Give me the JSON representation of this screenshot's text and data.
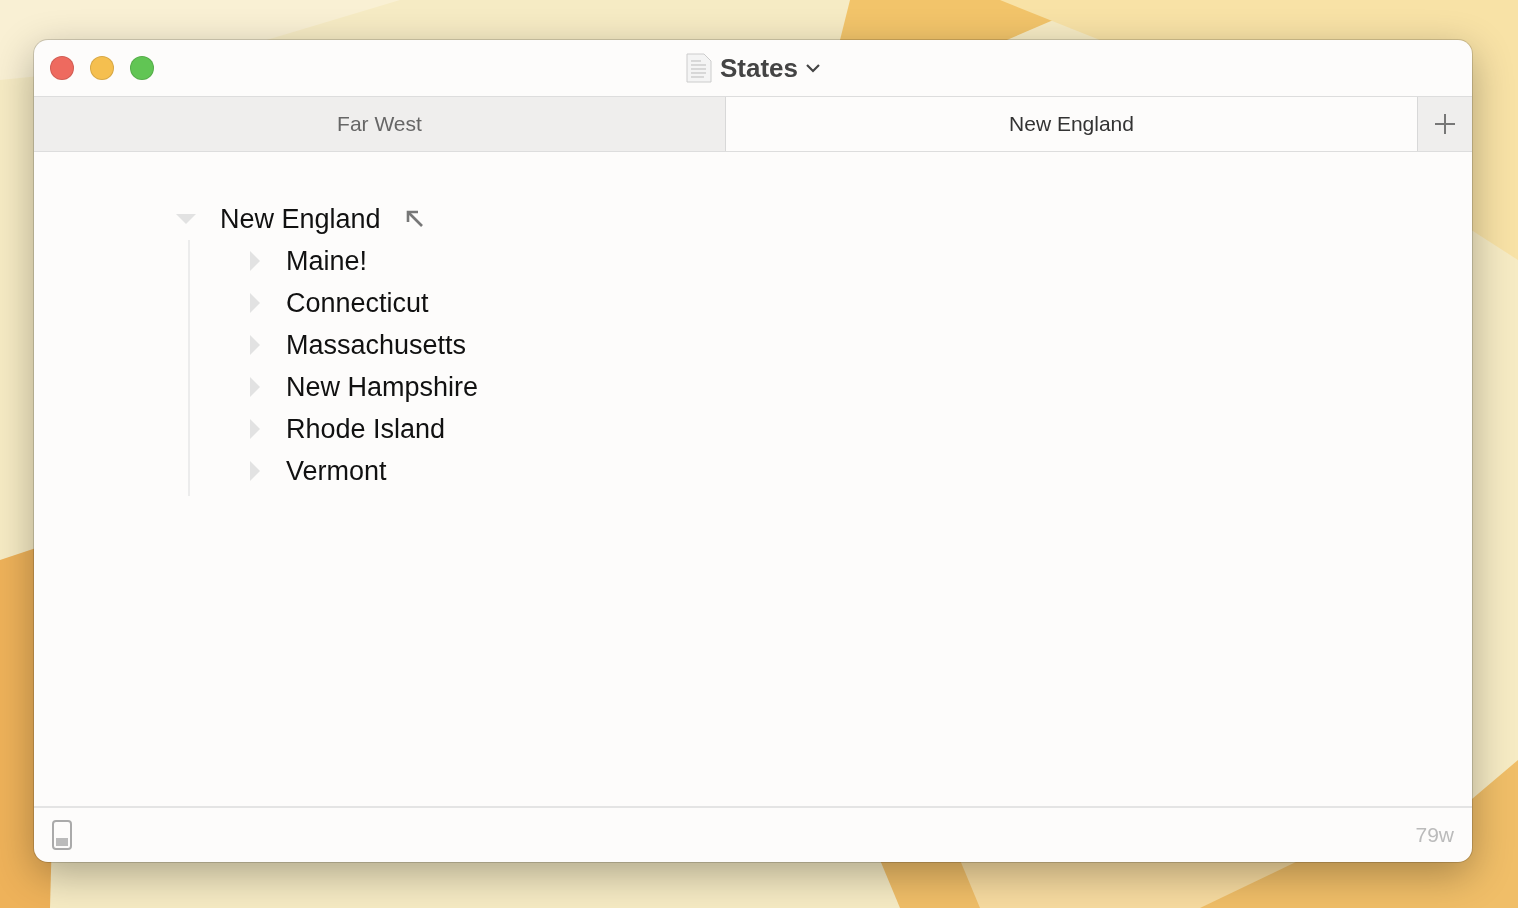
{
  "window": {
    "title": "States"
  },
  "tabs": [
    {
      "label": "Far West",
      "selected": false
    },
    {
      "label": "New England",
      "selected": true
    }
  ],
  "outline": [
    {
      "label": "New England",
      "expanded": true,
      "children": [
        {
          "label": "Maine!",
          "expanded": false
        },
        {
          "label": "Connecticut",
          "expanded": false
        },
        {
          "label": "Massachusetts",
          "expanded": false
        },
        {
          "label": "New Hampshire",
          "expanded": false
        },
        {
          "label": "Rhode Island",
          "expanded": false
        },
        {
          "label": "Vermont",
          "expanded": false
        }
      ]
    }
  ],
  "status_bar": {
    "word_count": "79w"
  }
}
